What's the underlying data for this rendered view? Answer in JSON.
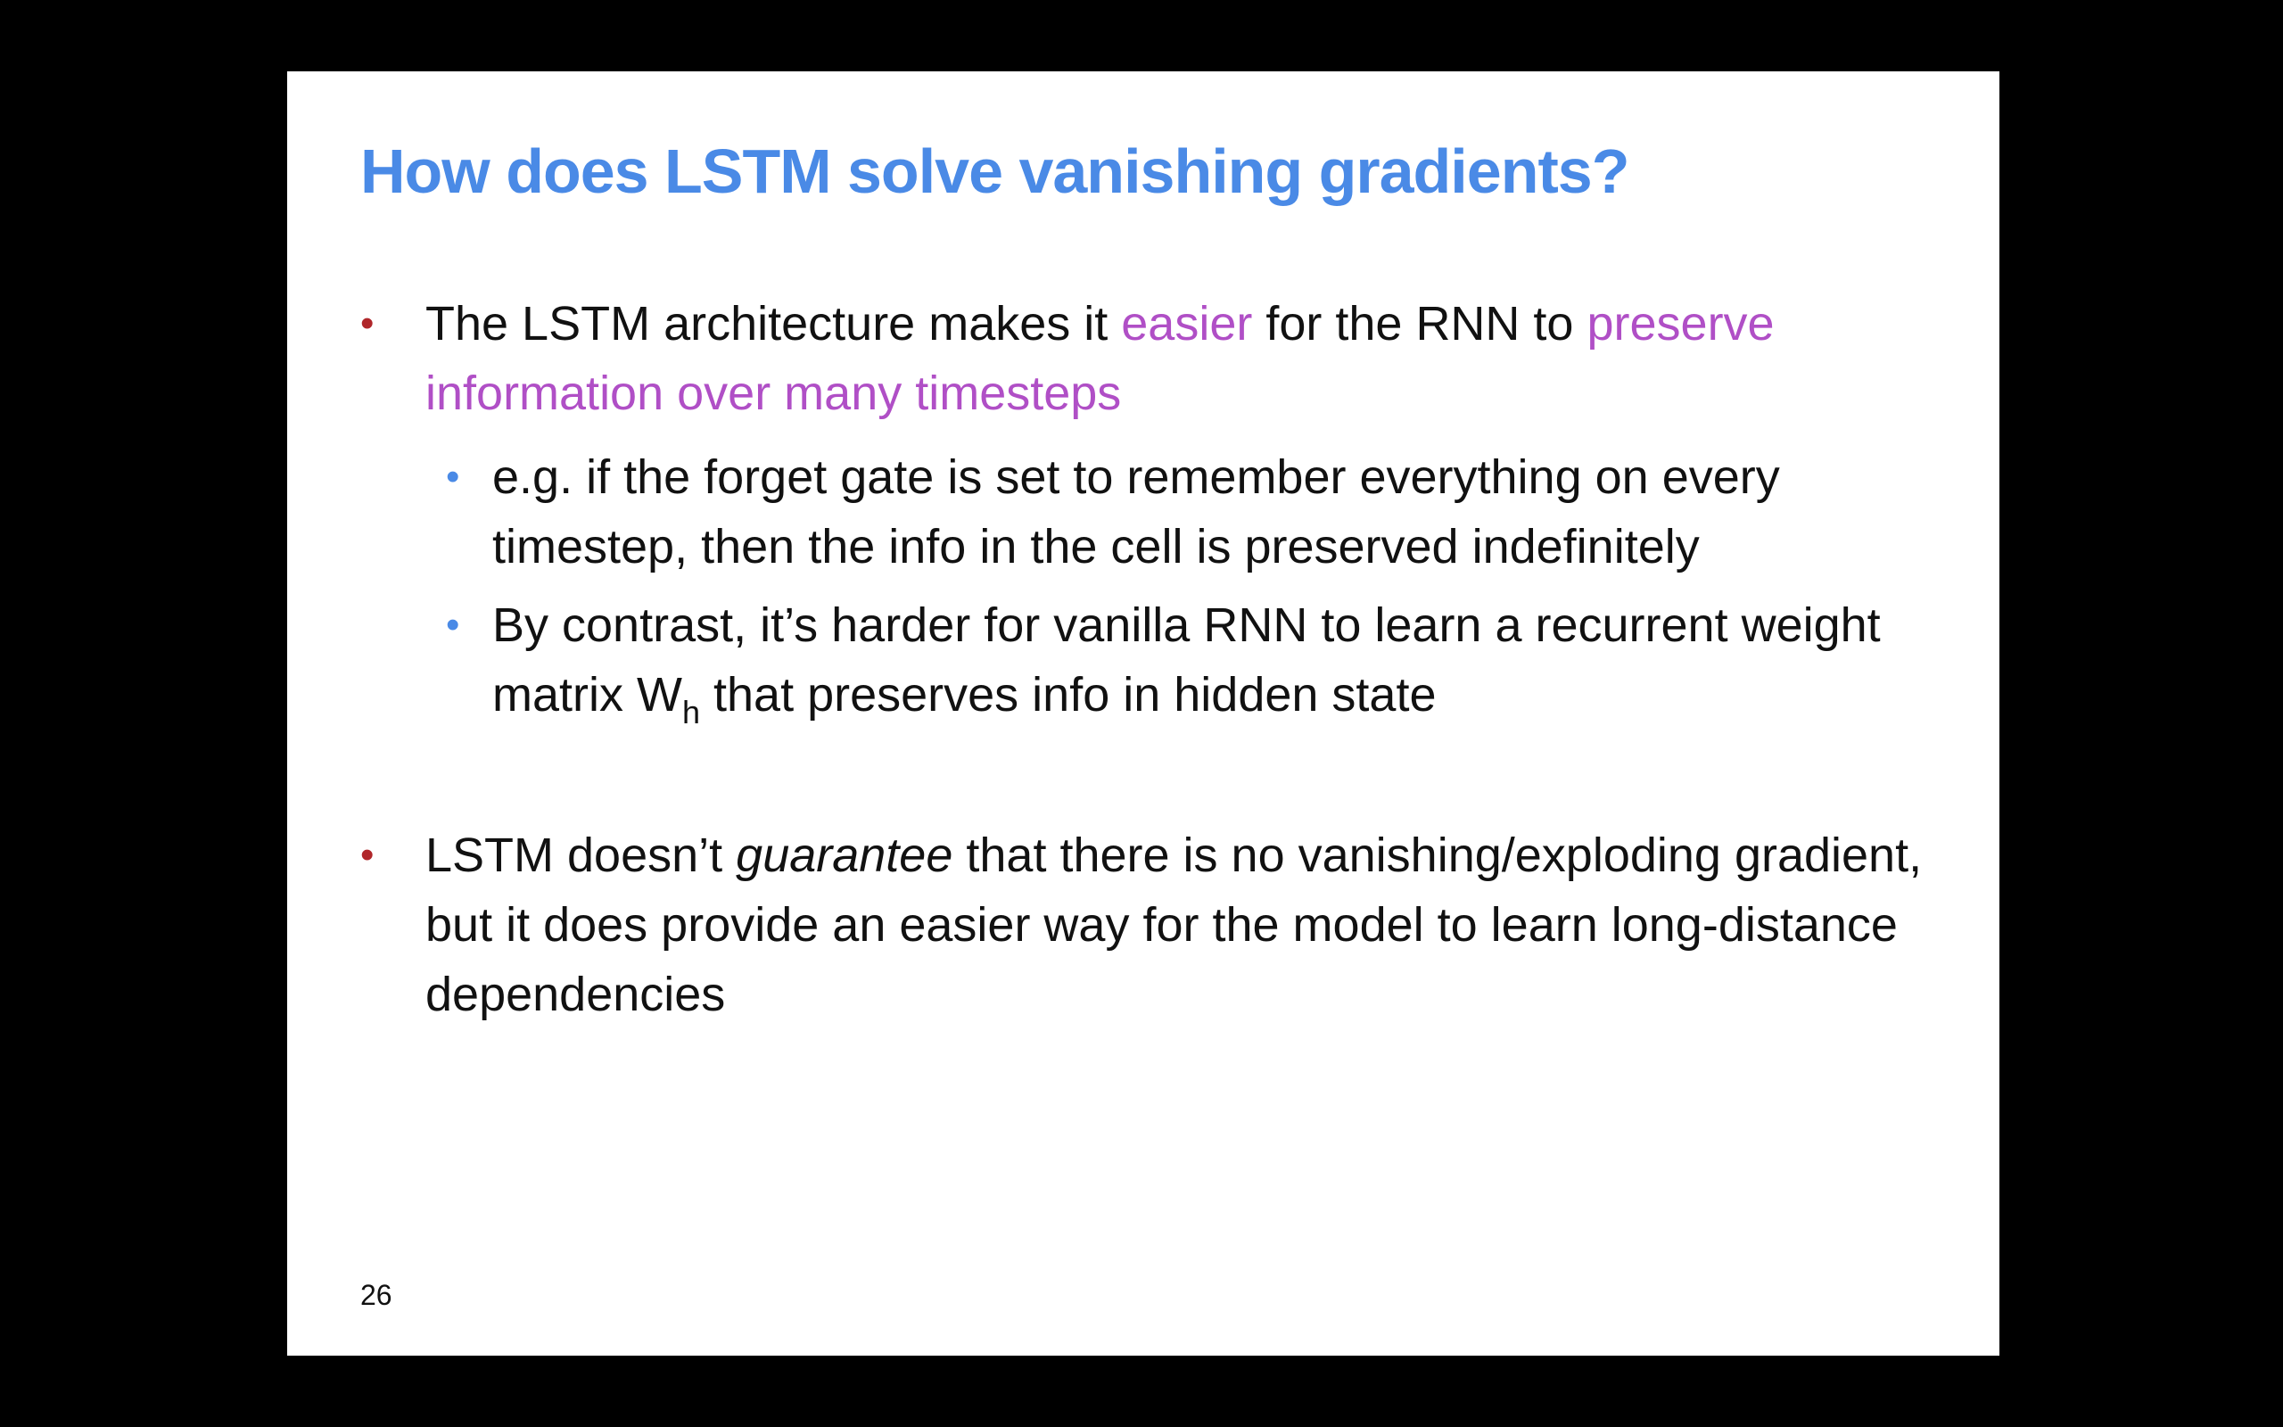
{
  "slide": {
    "title": "How does LSTM solve vanishing gradients?",
    "page_number": "26",
    "bullet1": {
      "part1": "The LSTM architecture makes it ",
      "highlight1": "easier",
      "part2": " for the RNN to ",
      "highlight2": "preserve information over many timesteps"
    },
    "sub1": "e.g. if the forget gate is set to remember everything on every timestep, then the info in the cell is preserved indefinitely",
    "sub2": {
      "part1": "By contrast, it’s harder for vanilla RNN to learn a recurrent weight matrix W",
      "subscript": "h",
      "part2": " that preserves info in hidden state"
    },
    "bullet2": {
      "part1": "LSTM doesn’t ",
      "emphasis": "guarantee",
      "part2": " that there is no vanishing/exploding gradient, but it does provide an easier way for the model to learn long-distance dependencies"
    },
    "marker_primary": "•",
    "marker_secondary": "•"
  },
  "colors": {
    "title": "#4a8ae6",
    "highlight": "#b04fc6",
    "bullet_primary": "#b0262a",
    "bullet_secondary": "#4a8ae6"
  }
}
